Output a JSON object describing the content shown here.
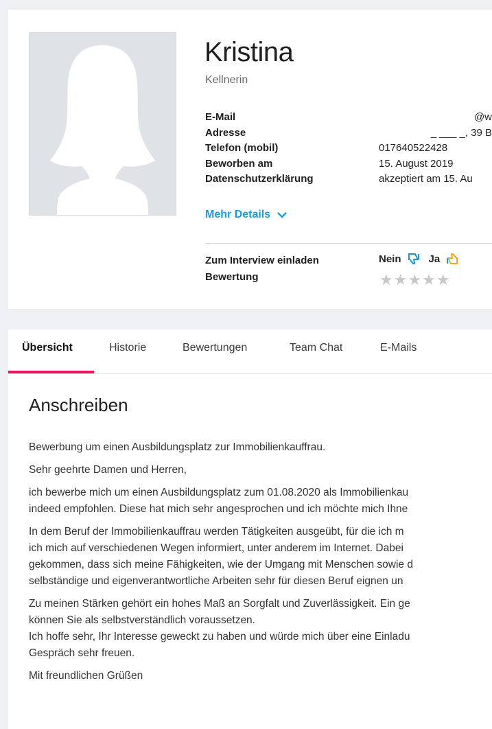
{
  "candidate": {
    "name": "Kristina",
    "role": "Kellnerin",
    "info": [
      {
        "label": "E-Mail",
        "value": "@w"
      },
      {
        "label": "Adresse",
        "value": "_ ___ _,   39 B"
      },
      {
        "label": "Telefon (mobil)",
        "value": "017640522428"
      },
      {
        "label": "Beworben am",
        "value": "15. August 2019"
      },
      {
        "label": "Datenschutzerklärung",
        "value": "akzeptiert am 15. Au"
      }
    ],
    "more_details": "Mehr Details",
    "interview_label": "Zum Interview einladen",
    "rating_label": "Bewertung",
    "vote_no": "Nein",
    "vote_yes": "Ja",
    "stars": "★★★★★",
    "rating_value": 0
  },
  "tabs": [
    {
      "label": "Übersicht",
      "active": true
    },
    {
      "label": "Historie"
    },
    {
      "label": "Bewertungen"
    },
    {
      "label": "Team Chat"
    },
    {
      "label": "E-Mails"
    }
  ],
  "letter": {
    "title": "Anschreiben",
    "paragraphs": [
      [
        "Bewerbung um einen Ausbildungsplatz zur Immobilienkauffrau."
      ],
      [
        "Sehr geehrte Damen und Herren,"
      ],
      [
        "ich bewerbe mich um einen Ausbildungsplatz zum 01.08.2020 als Immobilienkau",
        "indeed empfohlen. Diese hat mich sehr angesprochen und ich möchte mich Ihne"
      ],
      [
        "In dem Beruf der Immobilienkauffrau werden Tätigkeiten ausgeübt, für die ich m",
        "ich mich auf verschiedenen Wegen informiert, unter anderem im Internet. Dabei",
        "gekommen, dass sich meine Fähigkeiten, wie der Umgang mit Menschen sowie d",
        "selbständige und eigenverantwortliche Arbeiten sehr für diesen Beruf eignen un"
      ],
      [
        "Zu meinen Stärken gehört ein hohes Maß an Sorgfalt und Zuverlässigkeit. Ein ge",
        "können Sie als selbstverständlich voraussetzen.",
        "Ich hoffe sehr, Ihr Interesse geweckt zu haben und würde mich über eine Einladu",
        "Gespräch sehr freuen."
      ],
      [
        "Mit freundlichen Grüßen"
      ]
    ]
  },
  "colors": {
    "accent": "#1a9bd7",
    "tab_underline": "#e8175d",
    "star_empty": "#c8c8c8"
  }
}
